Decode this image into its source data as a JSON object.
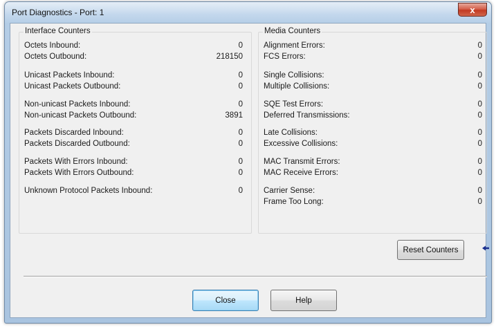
{
  "window": {
    "title": "Port Diagnostics - Port: 1",
    "close_glyph": "x"
  },
  "interface_counters": {
    "legend": "Interface Counters",
    "rows": [
      {
        "label": "Octets Inbound:",
        "value": "0"
      },
      {
        "label": "Octets Outbound:",
        "value": "218150"
      },
      {
        "label": "Unicast Packets Inbound:",
        "value": "0"
      },
      {
        "label": "Unicast Packets Outbound:",
        "value": "0"
      },
      {
        "label": "Non-unicast Packets Inbound:",
        "value": "0"
      },
      {
        "label": "Non-unicast Packets Outbound:",
        "value": "3891"
      },
      {
        "label": "Packets Discarded Inbound:",
        "value": "0"
      },
      {
        "label": "Packets Discarded Outbound:",
        "value": "0"
      },
      {
        "label": "Packets With Errors Inbound:",
        "value": "0"
      },
      {
        "label": "Packets With Errors Outbound:",
        "value": "0"
      },
      {
        "label": "Unknown Protocol Packets Inbound:",
        "value": "0"
      }
    ]
  },
  "media_counters": {
    "legend": "Media Counters",
    "rows": [
      {
        "label": "Alignment Errors:",
        "value": "0"
      },
      {
        "label": "FCS Errors:",
        "value": "0"
      },
      {
        "label": "Single Collisions:",
        "value": "0"
      },
      {
        "label": "Multiple Collisions:",
        "value": "0"
      },
      {
        "label": "SQE Test Errors:",
        "value": "0"
      },
      {
        "label": "Deferred Transmissions:",
        "value": "0"
      },
      {
        "label": "Late Collisions:",
        "value": "0"
      },
      {
        "label": "Excessive Collisions:",
        "value": "0"
      },
      {
        "label": "MAC Transmit Errors:",
        "value": "0"
      },
      {
        "label": "MAC Receive Errors:",
        "value": "0"
      },
      {
        "label": "Carrier Sense:",
        "value": "0"
      },
      {
        "label": "Frame Too Long:",
        "value": "0"
      }
    ]
  },
  "buttons": {
    "reset": "Reset Counters",
    "close": "Close",
    "help": "Help"
  },
  "icons": {
    "window_close": "close-icon",
    "reset_pointer": "arrow-left-icon"
  },
  "colors": {
    "arrow": "#1a2f8f",
    "close_button_focus": "#3c7fb1",
    "window_close_red": "#c23a22"
  }
}
